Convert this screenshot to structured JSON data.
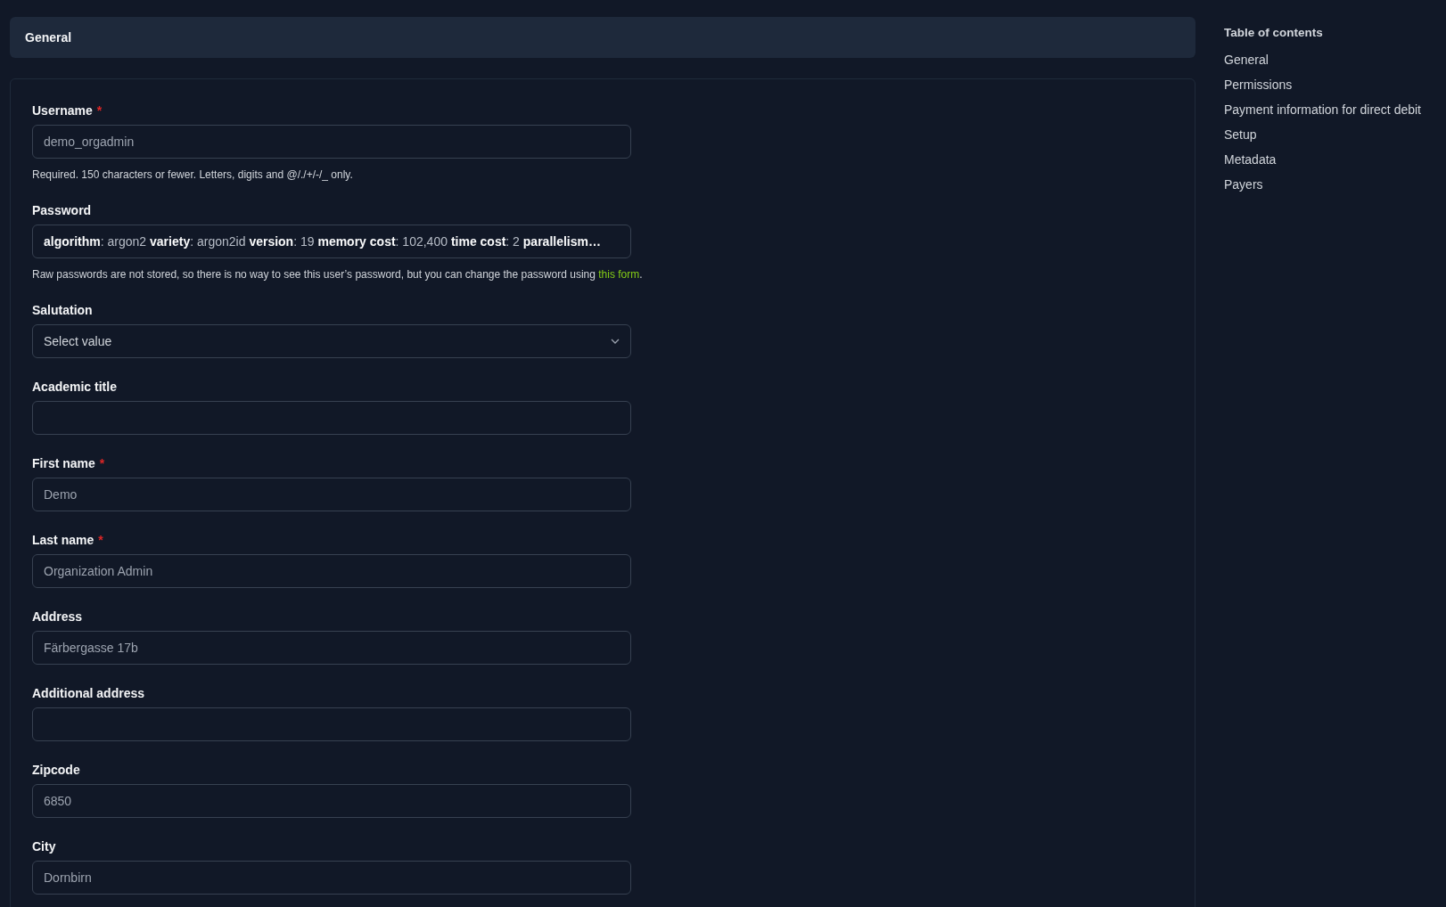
{
  "section_header": {
    "title": "General"
  },
  "fields": [
    {
      "kind": "text",
      "label": "Username",
      "required_mark": "*",
      "value": "demo_orgadmin",
      "help": {
        "text": "Required. 150 characters or fewer. Letters, digits and @/./+/-/_ only."
      }
    },
    {
      "kind": "summary",
      "label": "Password",
      "value": "**algorithm**: argon2 **variety**: argon2id **version**: 19 **memory cost**: 102,400 **time cost**: 2 **parallelism…**",
      "help": {
        "text": "Raw passwords are not stored, so there is no way to see this user’s password, but you can change the password using ",
        "link": "this form",
        "after": "."
      }
    },
    {
      "kind": "select",
      "label": "Salutation",
      "value": "Select value"
    },
    {
      "kind": "text",
      "label": "Academic title"
    },
    {
      "kind": "text",
      "label": "First name",
      "required_mark": "*",
      "value": "Demo"
    },
    {
      "kind": "text",
      "label": "Last name",
      "required_mark": "*",
      "value": "Organization Admin"
    },
    {
      "kind": "text",
      "label": "Address",
      "value": "Färbergasse 17b"
    },
    {
      "kind": "text",
      "label": "Additional address"
    },
    {
      "kind": "text",
      "label": "Zipcode",
      "value": "6850"
    },
    {
      "kind": "text",
      "label": "City",
      "value": "Dornbirn"
    }
  ],
  "table_of_contents": {
    "title": "Table of contents",
    "items": [
      "General",
      "Permissions",
      "Payment information for direct debit",
      "Setup",
      "Metadata",
      "Payers"
    ]
  }
}
